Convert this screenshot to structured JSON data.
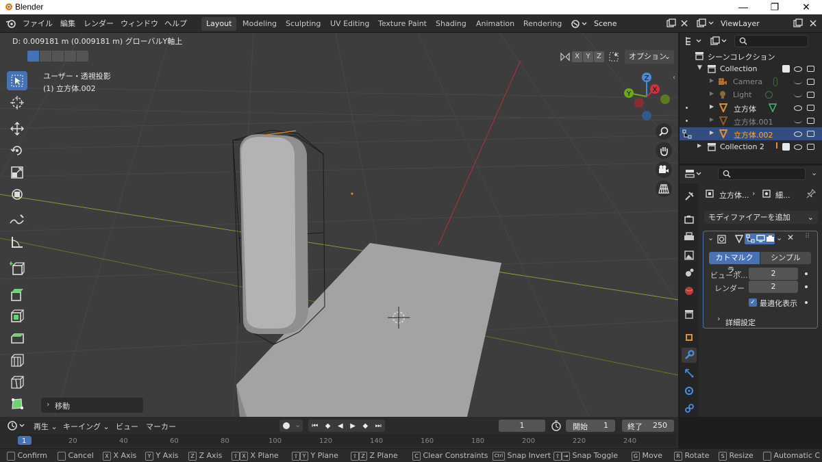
{
  "window": {
    "title": "Blender",
    "minimize": "—",
    "maximize": "❐",
    "close": "✕"
  },
  "menu": {
    "items": [
      "ファイル",
      "編集",
      "レンダー",
      "ウィンドウ",
      "ヘルプ"
    ],
    "tabs": [
      "Layout",
      "Modeling",
      "Sculpting",
      "UV Editing",
      "Texture Paint",
      "Shading",
      "Animation",
      "Rendering"
    ],
    "scene": "Scene",
    "view_layer": "ViewLayer"
  },
  "viewport": {
    "header_text": "D: 0.009181 m (0.009181 m) グローバルY軸上",
    "view_mode": "ユーザー・透視投影",
    "object_name": "(1) 立方体.002",
    "axes": [
      "X",
      "Y",
      "Z"
    ],
    "options_label": "オプション",
    "last_op": "移動",
    "gizmo_labels": {
      "x": "X",
      "y": "Y",
      "z": "Z"
    }
  },
  "outliner": {
    "search_placeholder": "",
    "scene_collection": "シーンコレクション",
    "rows": [
      {
        "label": "Collection",
        "dim": false,
        "selected": false
      },
      {
        "label": "Camera",
        "dim": true,
        "selected": false
      },
      {
        "label": "Light",
        "dim": true,
        "selected": false
      },
      {
        "label": "立方体",
        "dim": false,
        "selected": false
      },
      {
        "label": "立方体.001",
        "dim": true,
        "selected": false
      },
      {
        "label": "立方体.002",
        "dim": false,
        "selected": true
      },
      {
        "label": "Collection 2",
        "dim": false,
        "selected": false
      }
    ]
  },
  "properties": {
    "breadcrumb_obj": "立方体...",
    "breadcrumb_mod": "細...",
    "add_modifier": "モディファイアーを追加",
    "subdiv_mode_a": "カトマルクラ...",
    "subdiv_mode_b": "シンプル",
    "viewport_label": "ビューポ...",
    "viewport_value": "2",
    "render_label": "レンダー",
    "render_value": "2",
    "optimal_label": "最適化表示",
    "advanced_label": "詳細設定"
  },
  "timeline": {
    "play": "再生",
    "keying": "キーイング",
    "view": "ビュー",
    "marker": "マーカー",
    "current_frame": "1",
    "start_label": "開始",
    "start_value": "1",
    "end_label": "終了",
    "end_value": "250",
    "ruler": [
      "1",
      "20",
      "40",
      "60",
      "80",
      "100",
      "120",
      "140",
      "160",
      "180",
      "200",
      "220",
      "240"
    ]
  },
  "status": {
    "items": [
      {
        "key": "",
        "label": "Confirm"
      },
      {
        "key": "",
        "label": "Cancel"
      },
      {
        "key": "X",
        "label": "X Axis"
      },
      {
        "key": "Y",
        "label": "Y Axis"
      },
      {
        "key": "Z",
        "label": "Z Axis"
      },
      {
        "key": "X",
        "label": "X Plane"
      },
      {
        "key": "Y",
        "label": "Y Plane"
      },
      {
        "key": "Z",
        "label": "Z Plane"
      },
      {
        "key": "C",
        "label": "Clear Constraints"
      },
      {
        "key": "Ctrl",
        "label": "Snap Invert"
      },
      {
        "key": "",
        "label": "Snap Toggle"
      },
      {
        "key": "G",
        "label": "Move"
      },
      {
        "key": "R",
        "label": "Rotate"
      },
      {
        "key": "S",
        "label": "Resize"
      },
      {
        "key": "",
        "label": "Automatic C"
      }
    ]
  },
  "colors": {
    "accent": "#4772b3",
    "selected_text": "#ffaf29",
    "viewport_bg": "#3d3d3d"
  }
}
